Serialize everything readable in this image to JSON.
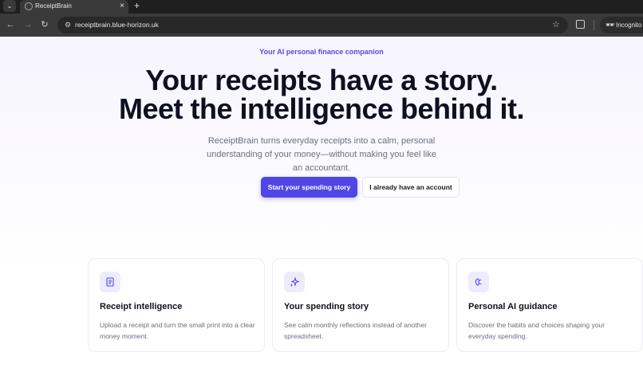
{
  "browser": {
    "tab_title": "ReceiptBrain",
    "url": "receiptbrain.blue-horizon.uk",
    "incognito_label": "Incognito",
    "tab_close": "×",
    "new_tab": "+",
    "menu_glyph": "⌄"
  },
  "hero": {
    "eyebrow": "Your AI personal finance companion",
    "headline_line1": "Your receipts have a story.",
    "headline_line2": "Meet the intelligence behind it.",
    "subtext": "ReceiptBrain turns everyday receipts into a calm, personal understanding of your money—without making you feel like an accountant.",
    "primary_cta": "Start your spending story",
    "secondary_cta": "I already have an account"
  },
  "features": [
    {
      "icon": "receipt-icon",
      "title": "Receipt intelligence",
      "body": "Upload a receipt and turn the small print into a clear money moment."
    },
    {
      "icon": "sparkles-icon",
      "title": "Your spending story",
      "body": "See calm monthly reflections instead of another spreadsheet."
    },
    {
      "icon": "brain-icon",
      "title": "Personal AI guidance",
      "body": "Discover the habits and choices shaping your everyday spending."
    }
  ],
  "colors": {
    "accent": "#4f46e5",
    "eyebrow": "#5a4bd8",
    "heading": "#0e1022",
    "muted": "#6b6f80"
  }
}
